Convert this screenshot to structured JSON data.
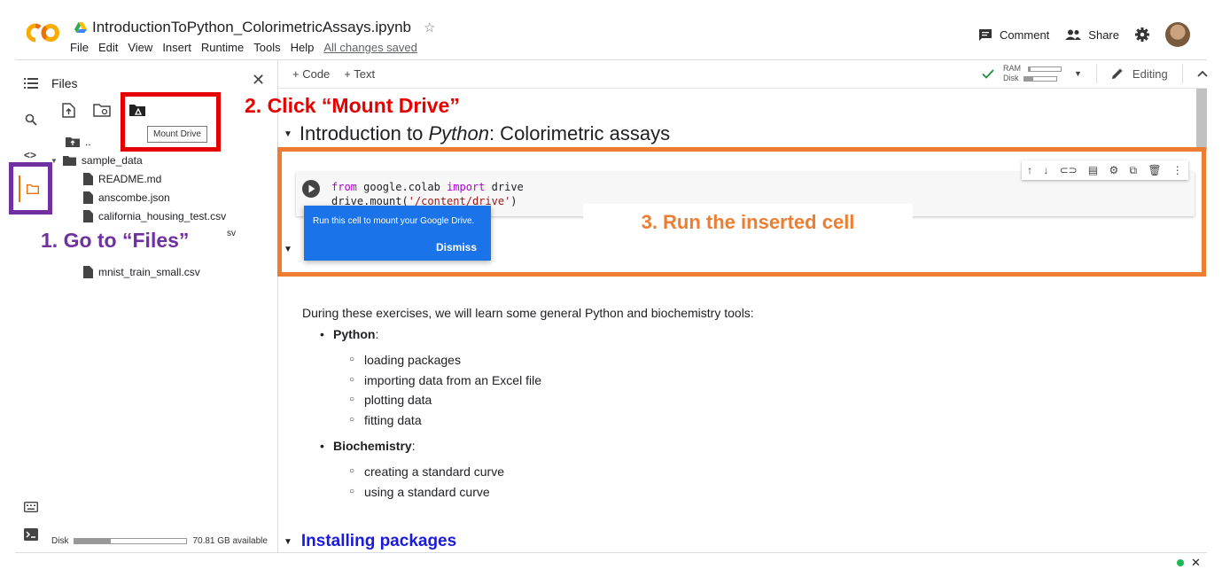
{
  "header": {
    "notebook_name": "IntroductionToPython_ColorimetricAssays.ipynb",
    "menus": [
      "File",
      "Edit",
      "View",
      "Insert",
      "Runtime",
      "Tools",
      "Help"
    ],
    "save_status": "All changes saved",
    "comment_label": "Comment",
    "share_label": "Share"
  },
  "files_panel": {
    "title": "Files",
    "tooltip": "Mount Drive",
    "tree": {
      "parent": "..",
      "folder": "sample_data",
      "files": [
        "README.md",
        "anscombe.json",
        "california_housing_test.csv",
        "sv",
        "mnist_train_small.csv"
      ]
    },
    "disk_label": "Disk",
    "disk_available": "70.81 GB available",
    "disk_usage_fraction": 0.32
  },
  "annotations": {
    "step1": "1. Go to “Files”",
    "step2": "2. Click “Mount Drive”",
    "step3": "3. Run the inserted cell"
  },
  "toolbar": {
    "code_label": "+ Code",
    "text_label": "+ Text",
    "ram_label": "RAM",
    "disk_label": "Disk",
    "ram_fraction": 0.05,
    "disk_fraction": 0.3,
    "editing_label": "Editing"
  },
  "notebook": {
    "section_title_pre": "Introduction to ",
    "section_title_em": "Python",
    "section_title_post": ": Colorimetric assays",
    "code_line1_kw1": "from",
    "code_line1_mod": " google.colab ",
    "code_line1_kw2": "import",
    "code_line1_name": " drive",
    "code_line2_pre": "drive.mount(",
    "code_line2_str": "'/content/drive'",
    "code_line2_post": ")",
    "popup_text": "Run this cell to mount your Google Drive.",
    "popup_dismiss": "Dismiss",
    "intro": "During these exercises, we will learn some general Python and biochemistry tools:",
    "python_label": "Python",
    "python_items": [
      "loading packages",
      "importing data from an Excel file",
      "plotting data",
      "fitting data"
    ],
    "biochem_label": "Biochemistry",
    "biochem_items": [
      "creating a standard curve",
      "using a standard curve"
    ],
    "installing_title": "Installing packages"
  },
  "colors": {
    "step1": "#7030a0",
    "step2": "#e60000",
    "step3": "#ed7d31",
    "popup": "#1a73e8",
    "heading_link": "#1a1adf"
  }
}
